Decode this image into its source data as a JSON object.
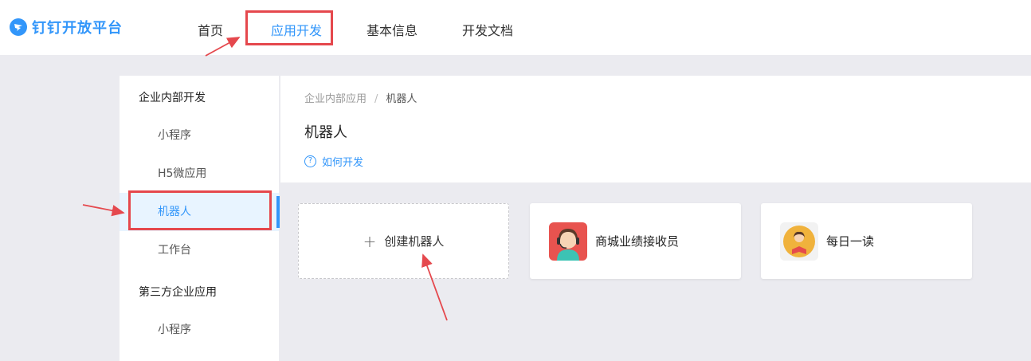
{
  "brand": {
    "name": "钉钉开放平台"
  },
  "nav": {
    "items": [
      {
        "label": "首页"
      },
      {
        "label": "应用开发"
      },
      {
        "label": "基本信息"
      },
      {
        "label": "开发文档"
      }
    ],
    "active_index": 1
  },
  "sidebar": {
    "group_internal": "企业内部开发",
    "internal_items": [
      {
        "label": "小程序"
      },
      {
        "label": "H5微应用"
      },
      {
        "label": "机器人"
      },
      {
        "label": "工作台"
      }
    ],
    "active_item": "机器人",
    "group_third_party": "第三方企业应用",
    "third_party_items": [
      {
        "label": "小程序"
      }
    ]
  },
  "main": {
    "breadcrumb": {
      "parent": "企业内部应用",
      "separator": "/",
      "current": "机器人"
    },
    "title": "机器人",
    "help_link": "如何开发",
    "create_card": {
      "plus": "+",
      "label": "创建机器人"
    },
    "apps": [
      {
        "name": "商城业绩接收员",
        "icon": "customer-service-avatar-icon"
      },
      {
        "name": "每日一读",
        "icon": "reading-avatar-icon"
      }
    ]
  },
  "colors": {
    "accent": "#3296fa",
    "highlight": "#e5484d",
    "page_bg": "#ebebf0"
  }
}
